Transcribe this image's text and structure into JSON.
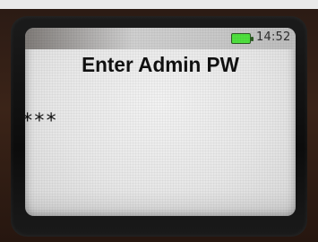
{
  "status_bar": {
    "time": "14:52",
    "battery_icon": "battery-full-icon",
    "battery_color": "#4fe13f"
  },
  "screen": {
    "title": "Enter Admin PW",
    "password_masked": "***"
  }
}
